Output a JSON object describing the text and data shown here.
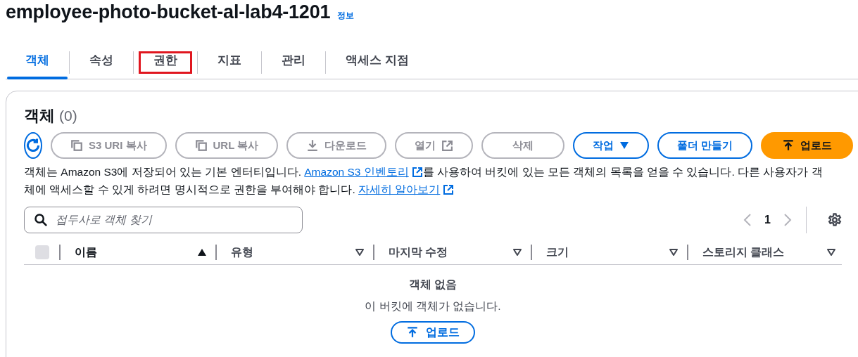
{
  "header": {
    "title": "employee-photo-bucket-al-lab4-1201",
    "info_link": "정보"
  },
  "tabs": [
    {
      "label": "객체",
      "selected": true,
      "highlighted": false
    },
    {
      "label": "속성",
      "selected": false,
      "highlighted": false
    },
    {
      "label": "권한",
      "selected": false,
      "highlighted": true
    },
    {
      "label": "지표",
      "selected": false,
      "highlighted": false
    },
    {
      "label": "관리",
      "selected": false,
      "highlighted": false
    },
    {
      "label": "액세스 지점",
      "selected": false,
      "highlighted": false
    }
  ],
  "objects_panel": {
    "title": "객체",
    "count": "(0)",
    "actions": [
      {
        "label": "S3 URI 복사",
        "kind": "copy",
        "disabled": true
      },
      {
        "label": "URL 복사",
        "kind": "copy",
        "disabled": true
      },
      {
        "label": "다운로드",
        "kind": "download",
        "disabled": true
      },
      {
        "label": "열기",
        "kind": "open",
        "disabled": true
      },
      {
        "label": "삭제",
        "kind": "plain",
        "disabled": true
      },
      {
        "label": "작업",
        "kind": "menu",
        "disabled": false
      },
      {
        "label": "폴더 만들기",
        "kind": "plain",
        "disabled": false
      },
      {
        "label": "업로드",
        "kind": "primary",
        "disabled": false
      }
    ],
    "description": [
      {
        "kind": "text",
        "text": "객체는 Amazon S3에 저장되어 있는 기본 엔터티입니다. "
      },
      {
        "kind": "link",
        "text": "Amazon S3 인벤토리"
      },
      {
        "kind": "text",
        "text": "를 사용하여 버킷에 있는 모든 객체의 목록을 얻을 수 있습니다. 다른 사용자가 객체에 액세스할 수 있게 하려면 명시적으로 권한을 부여해야 합니다. "
      },
      {
        "kind": "link",
        "text": "자세히 알아보기"
      }
    ],
    "search": {
      "placeholder": "접두사로 객체 찾기"
    },
    "pagination": {
      "page": "1",
      "prev_disabled": true,
      "next_disabled": true
    },
    "table": {
      "select_all_checked": false,
      "columns": [
        {
          "label": "이름",
          "sorted": true
        },
        {
          "label": "유형",
          "sorted": false
        },
        {
          "label": "마지막 수정",
          "sorted": false
        },
        {
          "label": "크기",
          "sorted": false
        },
        {
          "label": "스토리지 클래스",
          "sorted": false
        }
      ]
    },
    "empty_state": {
      "title": "객체 없음",
      "message": "이 버킷에 객체가 없습니다.",
      "button": "업로드"
    }
  }
}
